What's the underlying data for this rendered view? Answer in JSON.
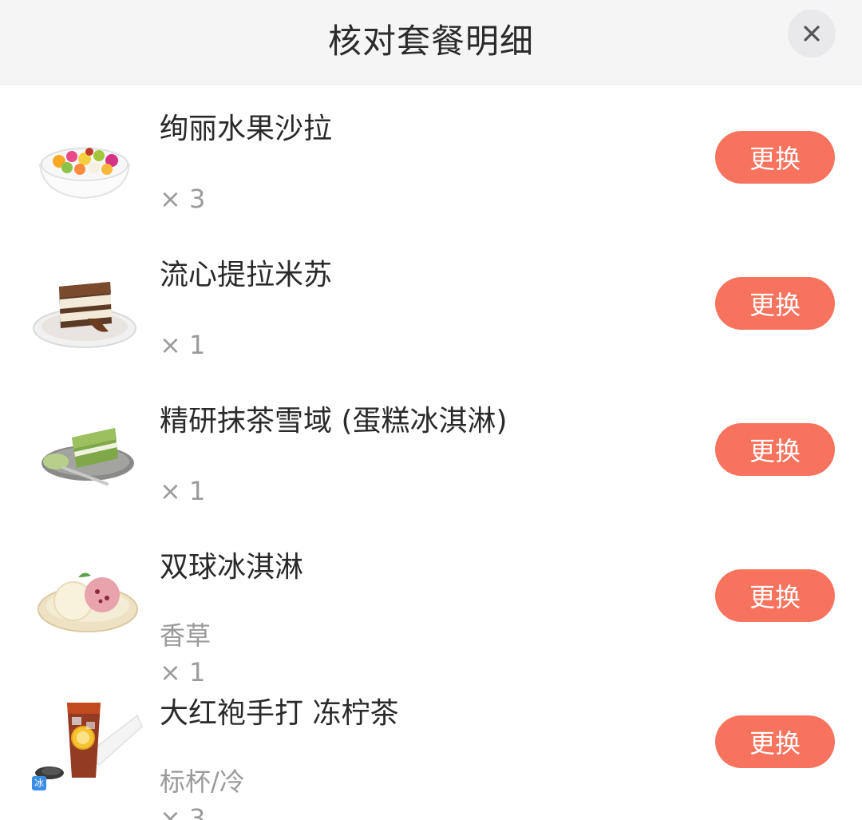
{
  "header": {
    "title": "核对套餐明细",
    "close_icon": "close-icon"
  },
  "items": [
    {
      "name": "绚丽水果沙拉",
      "spec": "",
      "qty": "× 3",
      "button": "更换",
      "image": "fruit-salad-image"
    },
    {
      "name": "流心提拉米苏",
      "spec": "",
      "qty": "× 1",
      "button": "更换",
      "image": "tiramisu-image"
    },
    {
      "name": "精研抹茶雪域 (蛋糕冰淇淋)",
      "spec": "",
      "qty": "× 1",
      "button": "更换",
      "image": "matcha-cake-image"
    },
    {
      "name": "双球冰淇淋",
      "spec": "香草",
      "qty": "× 1",
      "button": "更换",
      "image": "ice-cream-image"
    },
    {
      "name": "大红袍手打 冻柠茶",
      "spec": "标杯/冷",
      "qty": "× 3",
      "button": "更换",
      "image": "lemon-tea-image",
      "badge": "冰"
    }
  ],
  "colors": {
    "accent": "#f7735e",
    "header_bg": "#f5f5f6",
    "muted_text": "#9a9a9a"
  }
}
